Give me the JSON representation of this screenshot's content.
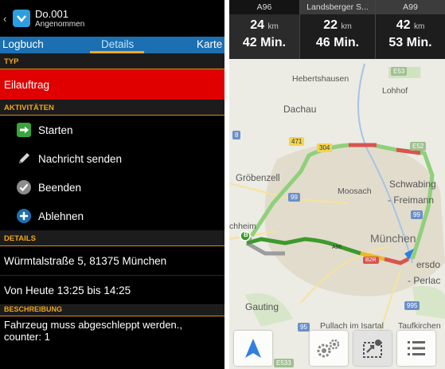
{
  "header": {
    "back": "‹",
    "title": "Do.001",
    "subtitle": "Angenommen"
  },
  "tabs": [
    {
      "label": "Logbuch"
    },
    {
      "label": "Details"
    },
    {
      "label": "Karte"
    }
  ],
  "sections": {
    "typ": "TYP",
    "aktivitaeten": "AKTIVITÄTEN",
    "details": "DETAILS",
    "beschreibung": "BESCHREIBUNG"
  },
  "typ_value": "Eilauftrag",
  "actions": [
    {
      "label": "Starten",
      "icon": "arrow-right-icon",
      "color": "#3aa43a"
    },
    {
      "label": "Nachricht senden",
      "icon": "pencil-icon",
      "color": "#cccccc"
    },
    {
      "label": "Beenden",
      "icon": "check-icon",
      "color": "#8c8c8c"
    },
    {
      "label": "Ablehnen",
      "icon": "plus-icon",
      "color": "#1c6fb1"
    }
  ],
  "details": {
    "address": "Würmtalstraße 5, 81375 München",
    "time": "Von Heute 13:25 bis 14:25"
  },
  "description": "Fahrzeug muss abgeschleppt werden., counter: 1",
  "routes": [
    {
      "name": "A96",
      "km": "24",
      "km_unit": "km",
      "min": "42",
      "min_unit": "Min."
    },
    {
      "name": "Landsberger S...",
      "km": "22",
      "km_unit": "km",
      "min": "46",
      "min_unit": "Min."
    },
    {
      "name": "A99",
      "km": "42",
      "km_unit": "km",
      "min": "53",
      "min_unit": "Min."
    }
  ],
  "map": {
    "places": {
      "hebertshausen": "Hebertshausen",
      "lohhof": "Lohhof",
      "dachau": "Dachau",
      "groebenzell": "Gröbenzell",
      "moosach": "Moosach",
      "schwabing": "Schwabing",
      "freimann": "- Freimann",
      "puchheim": "chheim",
      "muenchen": "München",
      "ersdo": "ersdo",
      "perlach": "- Perlac",
      "gauting": "Gauting",
      "pullach": "Pullach im Isartal",
      "taufkirchen": "Taufkirchen"
    },
    "shields": {
      "s471": "471",
      "s304": "304",
      "s8": "8",
      "s99a": "99",
      "s99b": "99",
      "e53": "E53",
      "e52": "E52",
      "a96": "A96",
      "b2r": "B2R",
      "s995": "995",
      "s95": "95",
      "e533": "E533"
    },
    "marker_start": "B"
  },
  "colors": {
    "accent": "#f2a71b",
    "tabbar": "#1c6fb1",
    "urgent": "#e00000",
    "route_green": "#3c9a2c",
    "route_alt": "#8fd07a"
  }
}
